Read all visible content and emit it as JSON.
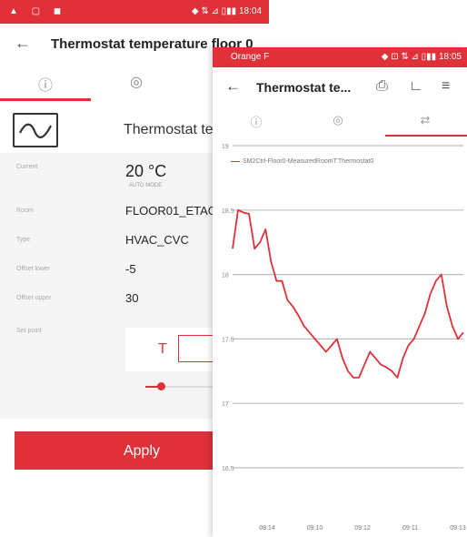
{
  "back_screen": {
    "status_bar": {
      "left_icons": "▲ ▢ ◼",
      "right_text": "◆ ⇅ ⊿ ▯▮▮ 18:04"
    },
    "toolbar": {
      "title": "Thermostat temperature floor 0"
    },
    "device": {
      "name": "Thermostat temperature floor 0"
    },
    "properties": [
      {
        "label": "Current",
        "value": "20 °C",
        "sub": "AUTO MODE"
      },
      {
        "label": "Room",
        "value": "FLOOR01_ETAGE"
      },
      {
        "label": "Type",
        "value": "HVAC_CVC"
      },
      {
        "label": "Offset lower",
        "value": "-5"
      },
      {
        "label": "Offset upper",
        "value": "30"
      },
      {
        "label": "Set point",
        "value": ""
      }
    ],
    "setpoint_unit": "T",
    "apply_label": "Apply"
  },
  "front_screen": {
    "status_bar": {
      "carrier": "Orange F",
      "right_text": "◆ ⊡ ⇅ ⊿ ▯▮▮ 18:05"
    },
    "toolbar": {
      "title": "Thermostat te..."
    },
    "icons": {
      "toolbar": [
        "export-icon",
        "chart-icon",
        "filter-icon"
      ],
      "tabs": [
        "info-icon",
        "eye-icon",
        "history-icon"
      ]
    }
  },
  "chart_data": {
    "type": "line",
    "legend": "SM2Ctrl-Floor0-MeasuredRoomT.Thermostat0",
    "ylim": [
      16.5,
      19
    ],
    "y_ticks": [
      16.5,
      17,
      17.5,
      18,
      18.5,
      19
    ],
    "y_tick_labels": [
      "16.5",
      "17",
      "17.5",
      "18",
      "18.5",
      "19"
    ],
    "x_tick_labels": [
      "08:14",
      "09:10",
      "09:12",
      "09:11",
      "09:13"
    ],
    "x": [
      0,
      1,
      2,
      3,
      4,
      5,
      6,
      7,
      8,
      9,
      10,
      11,
      12,
      13,
      14,
      15,
      16,
      17,
      18,
      19,
      20,
      21,
      22,
      23,
      24,
      25,
      26,
      27,
      28,
      29,
      30,
      31,
      32,
      33,
      34,
      35,
      36,
      37,
      38,
      39,
      40,
      41,
      42
    ],
    "values": [
      18.2,
      18.5,
      18.48,
      18.47,
      18.2,
      18.25,
      18.35,
      18.1,
      17.95,
      17.95,
      17.8,
      17.75,
      17.68,
      17.6,
      17.55,
      17.5,
      17.45,
      17.4,
      17.45,
      17.5,
      17.35,
      17.25,
      17.2,
      17.2,
      17.3,
      17.4,
      17.35,
      17.3,
      17.28,
      17.25,
      17.2,
      17.35,
      17.45,
      17.5,
      17.6,
      17.7,
      17.85,
      17.95,
      18.0,
      17.75,
      17.6,
      17.5,
      17.55
    ],
    "color": "#e0303a",
    "grid": true
  },
  "colors": {
    "accent": "#e0303a"
  }
}
